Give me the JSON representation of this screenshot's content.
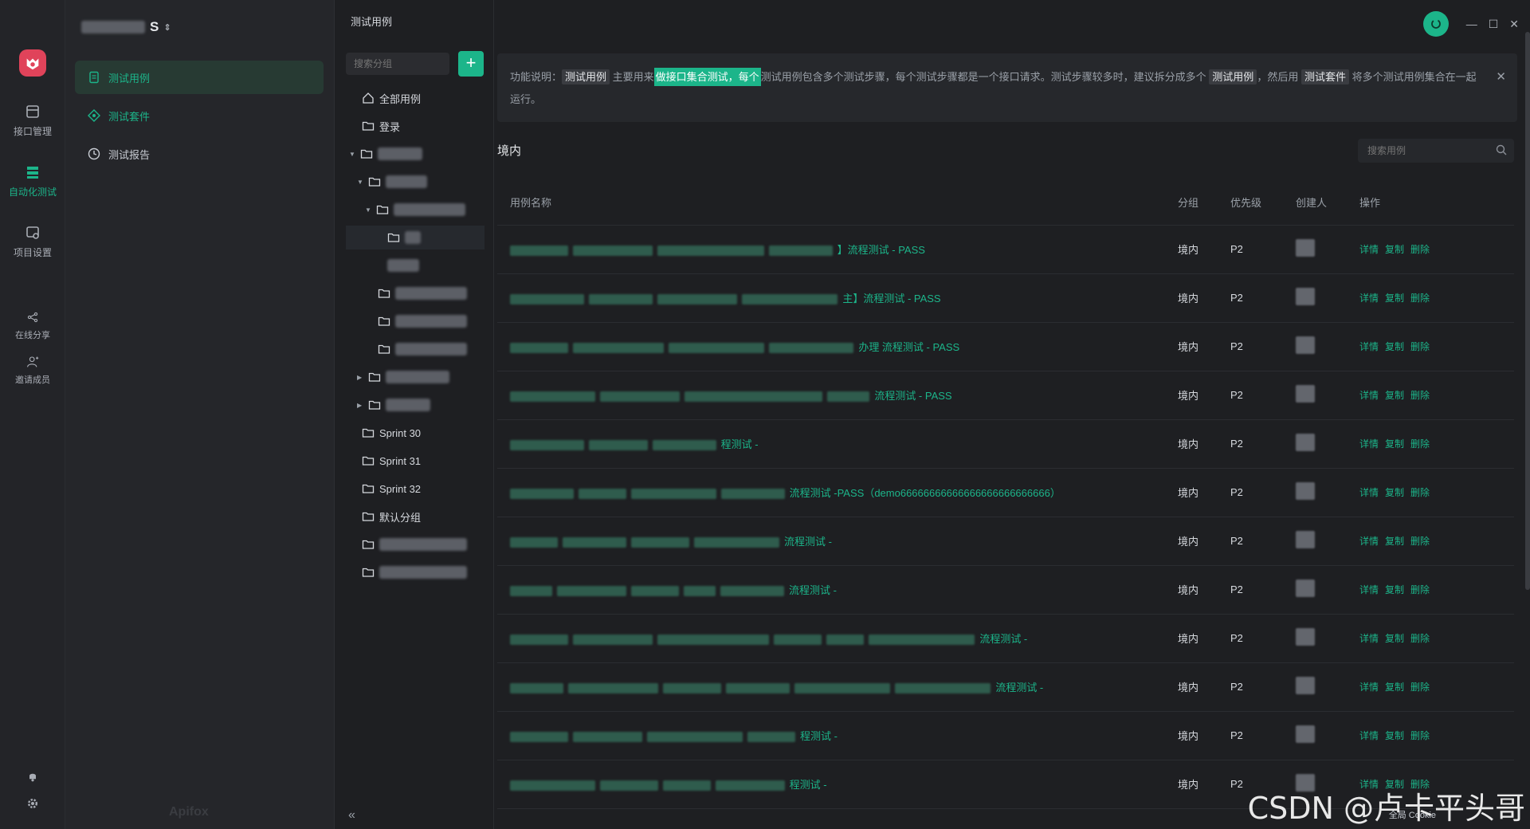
{
  "rail": {
    "items": [
      {
        "label": "接口管理",
        "icon": "api-icon"
      },
      {
        "label": "自动化测试",
        "icon": "automation-icon"
      },
      {
        "label": "项目设置",
        "icon": "settings-icon"
      },
      {
        "label": "在线分享",
        "icon": "share-icon"
      },
      {
        "label": "邀请成员",
        "icon": "invite-icon"
      }
    ]
  },
  "sidebar": {
    "project_suffix": "S",
    "items": [
      {
        "label": "测试用例"
      },
      {
        "label": "测试套件"
      },
      {
        "label": "测试报告"
      }
    ],
    "brand": "Apifox"
  },
  "tree": {
    "tab_title": "测试用例",
    "search_placeholder": "搜索分组",
    "add_label": "+",
    "nodes": [
      {
        "label": "全部用例"
      },
      {
        "label": "登录"
      },
      {
        "label": "Sprint 30"
      },
      {
        "label": "Sprint 31"
      },
      {
        "label": "Sprint 32"
      },
      {
        "label": "默认分组"
      }
    ]
  },
  "notice": {
    "prefix": "功能说明：",
    "tag1": "测试用例",
    "t1": " 主要用来",
    "highlight": "做接口集合测试，每个",
    "t2": "测试用例包含多个测试步骤，每个测试步骤都是一个接口请求。测试步骤较多时，建议拆分成多个 ",
    "tag2": "测试用例",
    "t3": "，然后用 ",
    "tag3": "测试套件",
    "t4": " 将多个测试用例集合在一起运行。"
  },
  "main": {
    "section_title": "境内",
    "search_placeholder": "搜索用例",
    "columns": {
      "name": "用例名称",
      "group": "分组",
      "priority": "优先级",
      "creator": "创建人",
      "ops": "操作"
    },
    "rows": [
      {
        "name": "】流程测试 - PASS",
        "group": "境内",
        "priority": "P2"
      },
      {
        "name": "主】流程测试 - PASS",
        "group": "境内",
        "priority": "P2"
      },
      {
        "name": "办理 流程测试 - PASS",
        "group": "境内",
        "priority": "P2"
      },
      {
        "name": "流程测试 - PASS",
        "group": "境内",
        "priority": "P2"
      },
      {
        "name": "程测试 -",
        "group": "境内",
        "priority": "P2"
      },
      {
        "name": "流程测试 -PASS（demo66666666666666666666666666）",
        "group": "境内",
        "priority": "P2"
      },
      {
        "name": "流程测试 -",
        "group": "境内",
        "priority": "P2"
      },
      {
        "name": "流程测试 -",
        "group": "境内",
        "priority": "P2"
      },
      {
        "name": "流程测试 -",
        "group": "境内",
        "priority": "P2"
      },
      {
        "name": "流程测试 -",
        "group": "境内",
        "priority": "P2"
      },
      {
        "name": "程测试 -",
        "group": "境内",
        "priority": "P2"
      },
      {
        "name": "程测试 -",
        "group": "境内",
        "priority": "P2"
      }
    ],
    "ops": {
      "detail": "详情",
      "copy": "复制",
      "delete": "删除"
    }
  },
  "footer": {
    "watermark": "CSDN @卢卡平头哥",
    "cookie": "全局 Cookie",
    "collapse": "«"
  },
  "colors": {
    "accent": "#1cb58a",
    "logo": "#e0435a",
    "background": "#1e1f22"
  }
}
